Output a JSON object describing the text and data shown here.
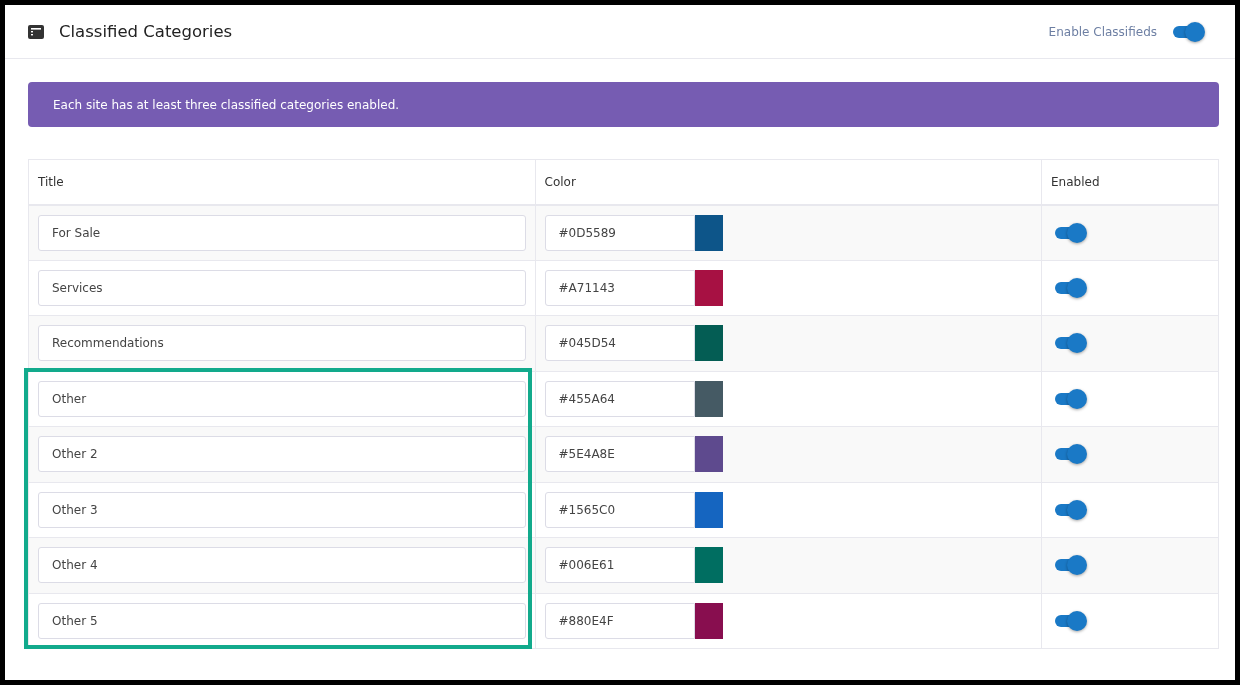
{
  "header": {
    "title": "Classified Categories",
    "toggle_label": "Enable Classifieds",
    "enabled": true
  },
  "notice": "Each site has at least three classified categories enabled.",
  "table": {
    "columns": [
      "Title",
      "Color",
      "Enabled"
    ],
    "rows": [
      {
        "title": "For Sale",
        "color": "#0d5589",
        "color_text": "#0D5589",
        "enabled": true,
        "highlighted": false
      },
      {
        "title": "Services",
        "color": "#a71143",
        "color_text": "#A71143",
        "enabled": true,
        "highlighted": false
      },
      {
        "title": "Recommendations",
        "color": "#045d54",
        "color_text": "#045D54",
        "enabled": true,
        "highlighted": false
      },
      {
        "title": "Other",
        "color": "#455a64",
        "color_text": "#455A64",
        "enabled": true,
        "highlighted": true
      },
      {
        "title": "Other 2",
        "color": "#5e4a8e",
        "color_text": "#5E4A8E",
        "enabled": true,
        "highlighted": true
      },
      {
        "title": "Other 3",
        "color": "#1565c0",
        "color_text": "#1565C0",
        "enabled": true,
        "highlighted": true
      },
      {
        "title": "Other 4",
        "color": "#006e61",
        "color_text": "#006E61",
        "enabled": true,
        "highlighted": true
      },
      {
        "title": "Other 5",
        "color": "#880e4f",
        "color_text": "#880E4F",
        "enabled": true,
        "highlighted": true
      }
    ]
  }
}
